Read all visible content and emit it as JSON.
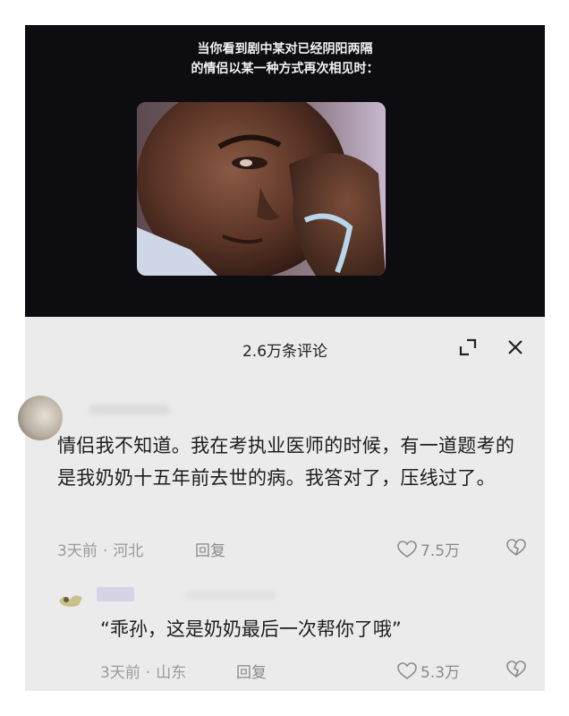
{
  "video": {
    "caption_line1": "当你看到剧中某对已经阴阳两隔",
    "caption_line2": "的情侣以某一种方式再次相见时："
  },
  "comments_panel": {
    "title": "2.6万条评论",
    "expand_icon": "expand-icon",
    "close_icon": "close-icon"
  },
  "comments": [
    {
      "text": "情侣我不知道。我在考执业医师的时候，有一道题考的是我奶奶十五年前去世的病。我答对了，压线过了。",
      "time": "3天前",
      "separator": "·",
      "location": "河北",
      "reply_label": "回复",
      "likes": "7.5万"
    }
  ],
  "reply": {
    "text": "“乖孙，这是奶奶最后一次帮你了哦”",
    "time": "3天前",
    "separator": "·",
    "location": "山东",
    "reply_label": "回复",
    "likes": "5.3万"
  },
  "colors": {
    "video_bg": "#0d0c10",
    "sheet_bg": "#ebebeb",
    "text_main": "#1d1d1d",
    "text_meta": "#9a9a9a"
  }
}
